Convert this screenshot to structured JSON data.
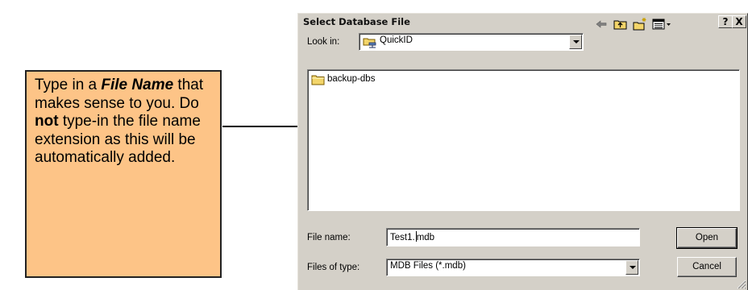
{
  "callout": {
    "t1": "Type in a ",
    "t2": "File Name",
    "t3": " that makes sense to you. Do ",
    "t4": "not",
    "t5": " type-in the file name extension as this will be automatically added."
  },
  "dialog": {
    "title": "Select Database File",
    "help_btn": "?",
    "close_btn": "X",
    "lookin_label": "Look in:",
    "lookin_value": "QuickID",
    "toolbar_icons": [
      "back-arrow-icon",
      "up-folder-icon",
      "new-folder-icon",
      "view-menu-icon"
    ],
    "items": [
      {
        "name": "backup-dbs",
        "icon": "folder-icon"
      }
    ],
    "filename_label": "File name:",
    "filename_before_caret": "Test1.",
    "filename_after_caret": "mdb",
    "filetype_label": "Files of type:",
    "filetype_value": "MDB Files (*.mdb)",
    "open_btn": "Open",
    "cancel_btn": "Cancel"
  },
  "colors": {
    "callout_fill": "#fdc487",
    "dialog_face": "#d4d0c8",
    "folder_yellow": "#f3d56a"
  }
}
